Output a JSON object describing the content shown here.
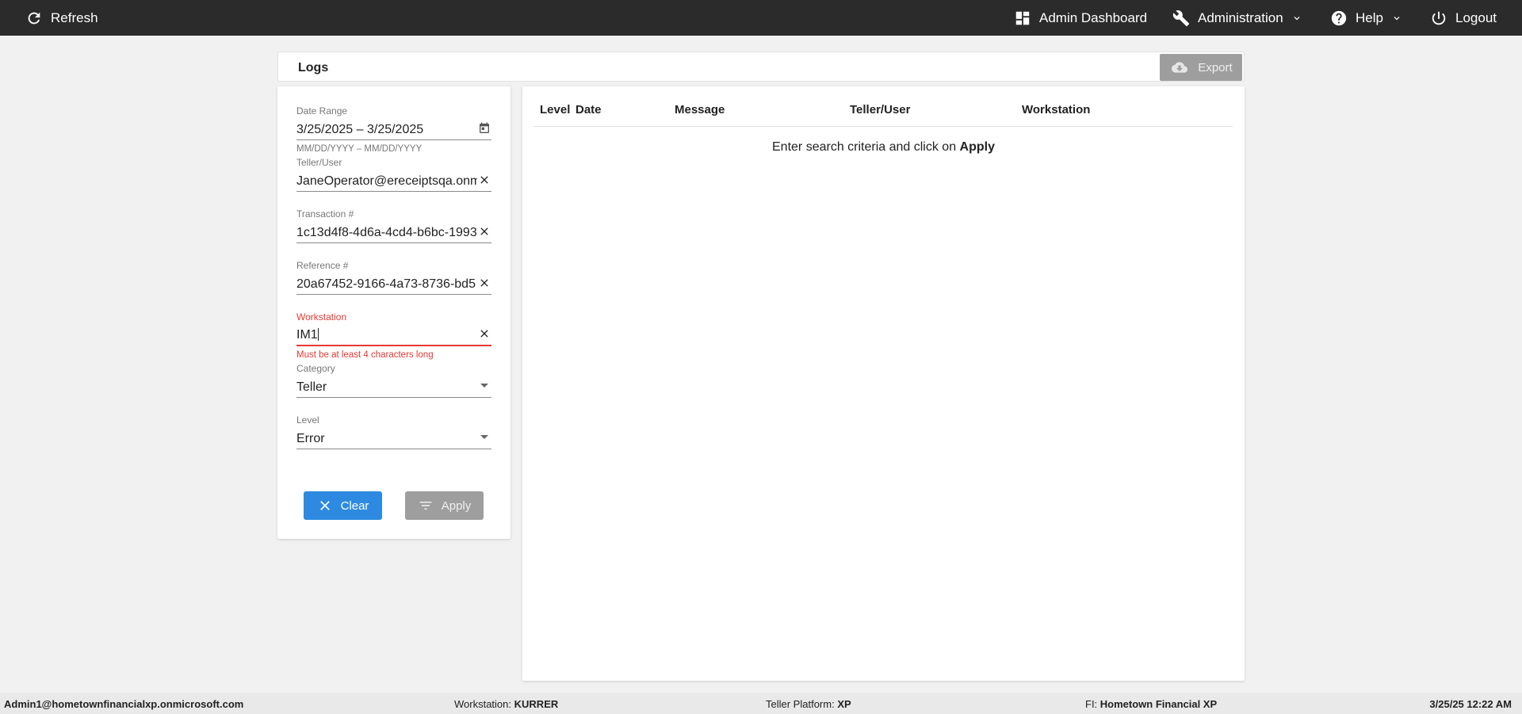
{
  "topbar": {
    "refresh_label": "Refresh",
    "admin_dashboard_label": "Admin Dashboard",
    "administration_label": "Administration",
    "help_label": "Help",
    "logout_label": "Logout"
  },
  "logs_header": {
    "title": "Logs",
    "export_label": "Export"
  },
  "filters": {
    "date_range": {
      "label": "Date Range",
      "value": "3/25/2025 – 3/25/2025",
      "hint": "MM/DD/YYYY – MM/DD/YYYY"
    },
    "teller_user": {
      "label": "Teller/User",
      "value": "JaneOperator@ereceiptsqa.onmicrosoft.com"
    },
    "transaction": {
      "label": "Transaction #",
      "value": "1c13d4f8-4d6a-4cd4-b6bc-1993"
    },
    "reference": {
      "label": "Reference #",
      "value": "20a67452-9166-4a73-8736-bd5"
    },
    "workstation": {
      "label": "Workstation",
      "value": "IM1",
      "error": "Must be at least 4 characters long"
    },
    "category": {
      "label": "Category",
      "value": "Teller"
    },
    "level": {
      "label": "Level",
      "value": "Error"
    },
    "clear_label": "Clear",
    "apply_label": "Apply"
  },
  "results": {
    "columns": [
      "Level",
      "Date",
      "Message",
      "Teller/User",
      "Workstation"
    ],
    "empty_prefix": "Enter search criteria and click on ",
    "empty_action": "Apply"
  },
  "statusbar": {
    "user": "Admin1@hometownfinancialxp.onmicrosoft.com",
    "workstation_label": "Workstation:",
    "workstation_value": "KURRER",
    "platform_label": "Teller Platform:",
    "platform_value": "XP",
    "fi_label": "FI:",
    "fi_value": "Hometown Financial XP",
    "datetime": "3/25/25 12:22 AM"
  },
  "colors": {
    "topbar": "#2b2b2b",
    "primary": "#2d8ae0",
    "disabled": "#9e9e9e",
    "error": "#e53935"
  }
}
